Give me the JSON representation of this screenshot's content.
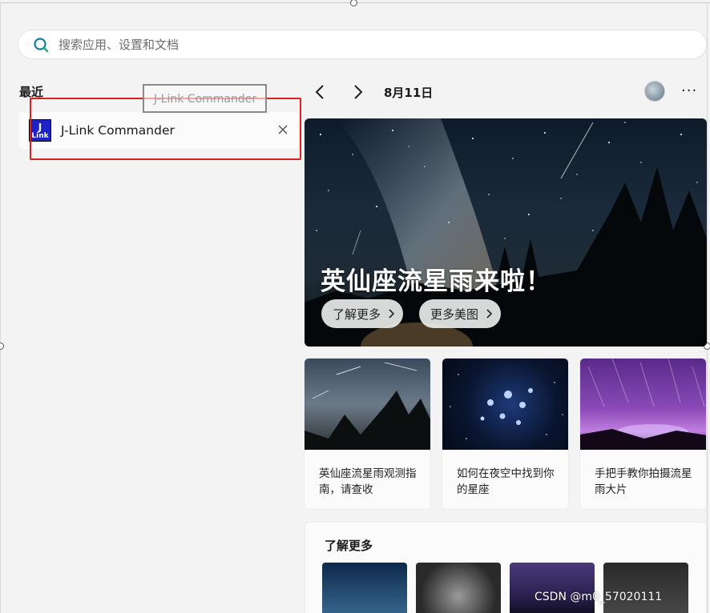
{
  "search": {
    "placeholder": "搜索应用、设置和文档"
  },
  "recent": {
    "title": "最近",
    "items": [
      {
        "name": "J-Link Commander",
        "logo_line1": "J",
        "logo_line2": "Link"
      }
    ],
    "tooltip": "J-Link Commander"
  },
  "feed": {
    "date": "8月11日",
    "more_label": "···",
    "hero": {
      "title": "英仙座流星雨来啦！",
      "buttons": [
        "了解更多",
        "更多美图"
      ]
    },
    "cards": [
      {
        "caption": "英仙座流星雨观测指南，请查收"
      },
      {
        "caption": "如何在夜空中找到你的星座"
      },
      {
        "caption": "手把手教你拍摄流星雨大片"
      }
    ],
    "learn_more": {
      "title": "了解更多"
    }
  },
  "watermark": "CSDN @m0_57020111",
  "colors": {
    "highlight": "#e02020",
    "logo_bg": "#1d22c4",
    "search_icon": "#0a7fa8"
  }
}
